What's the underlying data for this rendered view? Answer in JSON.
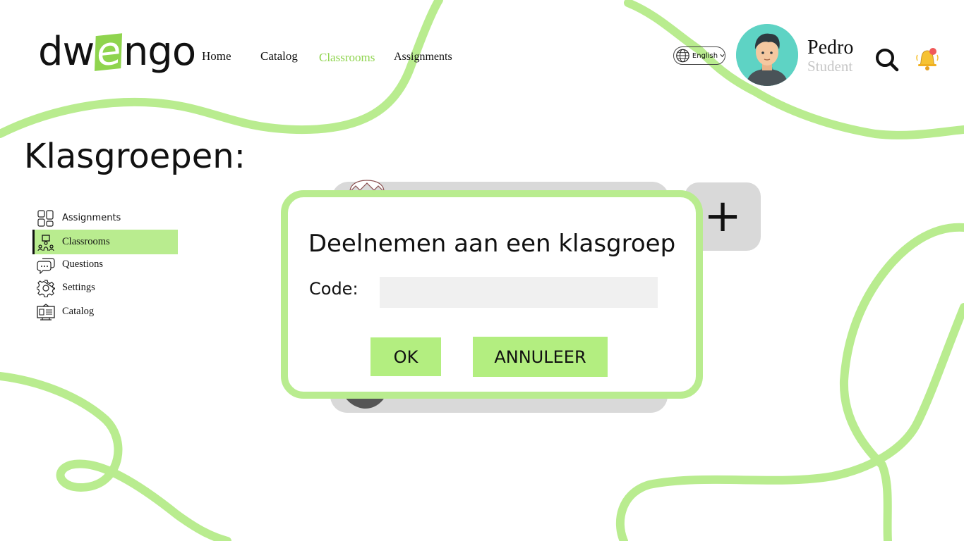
{
  "header": {
    "logo": {
      "before": "dw",
      "accent": "e",
      "after": "ngo"
    },
    "nav": [
      {
        "label": "Home",
        "active": false
      },
      {
        "label": "Catalog",
        "active": false
      },
      {
        "label": "Classrooms",
        "active": true
      },
      {
        "label": "Assignments",
        "active": false
      }
    ],
    "language": "English",
    "user": {
      "name": "Pedro",
      "role": "Student"
    }
  },
  "page": {
    "title": "Klasgroepen:"
  },
  "sidebar": {
    "items": [
      {
        "label": "Assignments",
        "icon": "assignments-icon",
        "active": false
      },
      {
        "label": "Classrooms",
        "icon": "classroom-icon",
        "active": true
      },
      {
        "label": "Questions",
        "icon": "chat-bubbles-icon",
        "active": false
      },
      {
        "label": "Settings",
        "icon": "gear-icon",
        "active": false
      },
      {
        "label": "Catalog",
        "icon": "catalog-icon",
        "active": false
      }
    ]
  },
  "add_button": {
    "label": "+"
  },
  "modal": {
    "title": "Deelnemen aan een klasgroep",
    "code_label": "Code:",
    "code_value": "",
    "ok_label": "OK",
    "cancel_label": "ANNULEER"
  },
  "colors": {
    "accent": "#b9ec8f",
    "button": "#b3ee80",
    "nav_active": "#8fd44e",
    "card": "#d9d9d9"
  }
}
